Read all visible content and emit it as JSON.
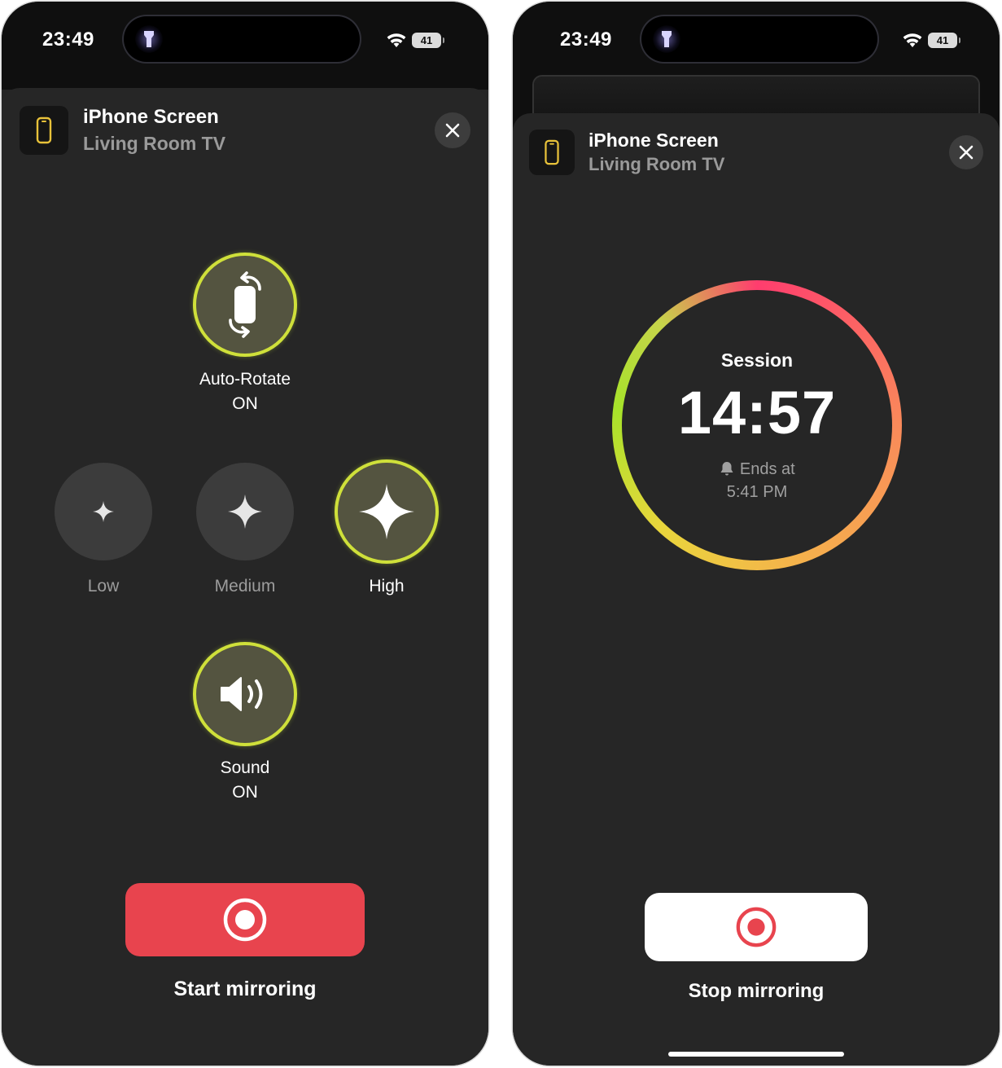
{
  "left": {
    "status": {
      "time": "23:49",
      "battery": "41"
    },
    "header": {
      "title": "iPhone Screen",
      "subtitle": "Living Room TV"
    },
    "controls": {
      "auto_rotate": {
        "label": "Auto-Rotate",
        "state": "ON"
      },
      "quality": {
        "options": [
          "Low",
          "Medium",
          "High"
        ],
        "selected": "High"
      },
      "sound": {
        "label": "Sound",
        "state": "ON"
      }
    },
    "action": {
      "label": "Start mirroring"
    }
  },
  "right": {
    "status": {
      "time": "23:49",
      "battery": "41"
    },
    "header": {
      "title": "iPhone Screen",
      "subtitle": "Living Room TV"
    },
    "session": {
      "label": "Session",
      "remaining": "14:57",
      "ends_label": "Ends at",
      "ends_time": "5:41 PM"
    },
    "action": {
      "label": "Stop mirroring"
    }
  },
  "colors": {
    "accent_red": "#e8444e",
    "toggle_ring": "#cfe03a",
    "ring_gradient": [
      "#ff3d6e",
      "#f7a24a",
      "#e9d63c",
      "#a6e22a"
    ]
  },
  "icons": [
    "flashlight-icon",
    "wifi-icon",
    "battery-icon",
    "phone-icon",
    "close-icon",
    "rotate-icon",
    "sparkle-icon",
    "speaker-icon",
    "record-icon",
    "bell-icon"
  ]
}
